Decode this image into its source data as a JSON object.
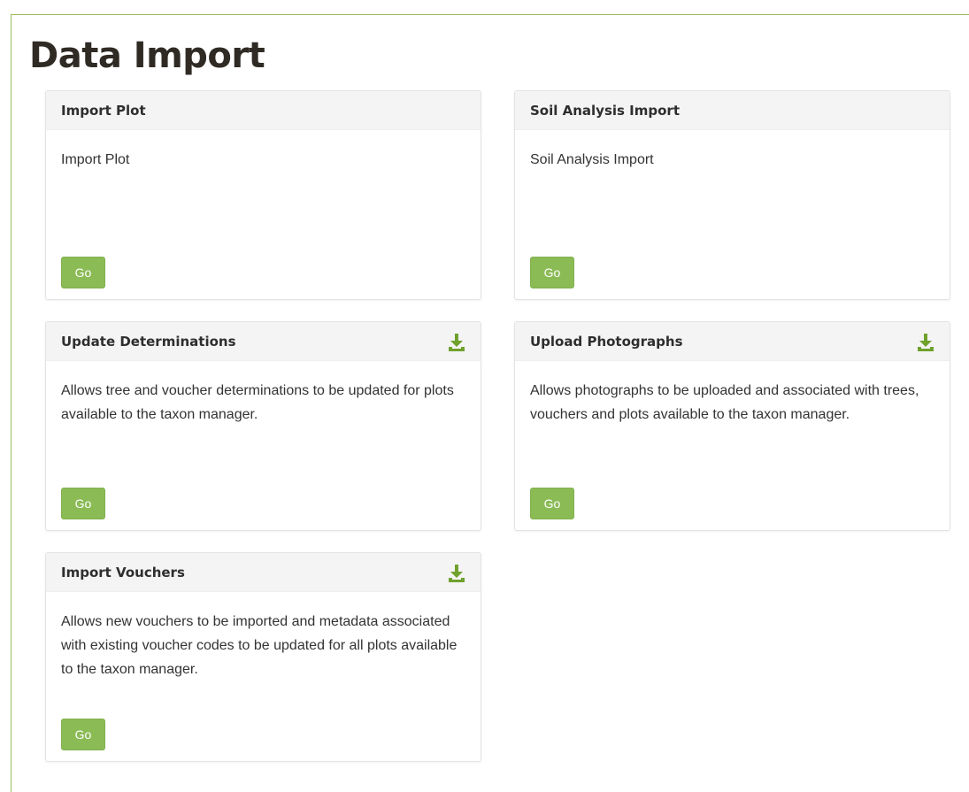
{
  "page": {
    "title": "Data Import"
  },
  "colors": {
    "accent": "#8bbb55",
    "frame_border": "#9bbd5c",
    "icon": "#6fa12d",
    "card_header_bg": "#f4f4f4"
  },
  "cards": [
    {
      "title": "Import Plot",
      "description": "Import Plot",
      "button_label": "Go",
      "icon": null
    },
    {
      "title": "Soil Analysis Import",
      "description": "Soil Analysis Import",
      "button_label": "Go",
      "icon": null
    },
    {
      "title": "Update Determinations",
      "description": "Allows tree and voucher determinations to be updated for plots available to the taxon manager.",
      "button_label": "Go",
      "icon": "download-icon"
    },
    {
      "title": "Upload Photographs",
      "description": "Allows photographs to be uploaded and associated with trees, vouchers and plots available to the taxon manager.",
      "button_label": "Go",
      "icon": "download-icon"
    },
    {
      "title": "Import Vouchers",
      "description": "Allows new vouchers to be imported and metadata associated with existing voucher codes to be updated for all plots available to the taxon manager.",
      "button_label": "Go",
      "icon": "download-icon"
    }
  ]
}
